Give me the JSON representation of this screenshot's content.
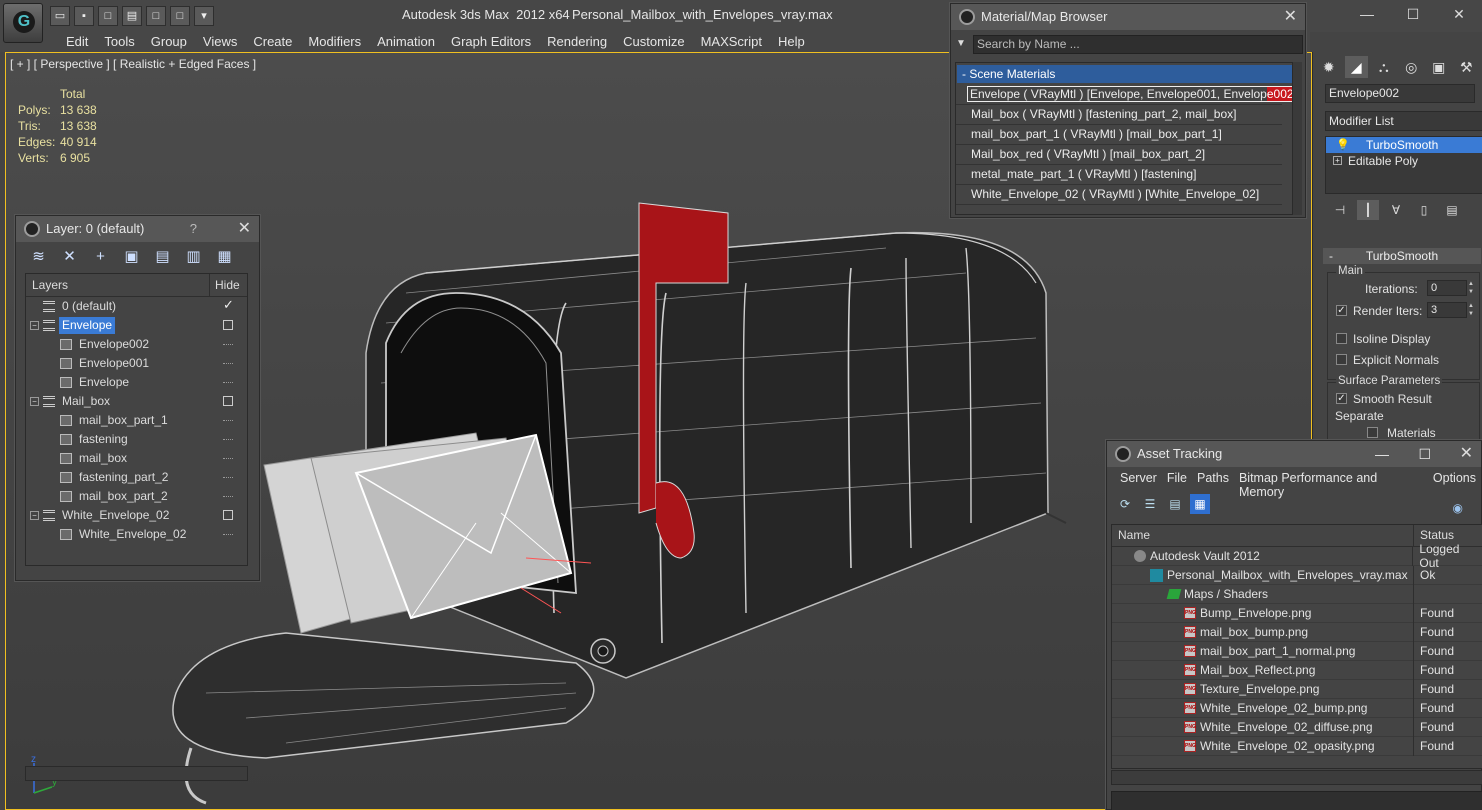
{
  "app": {
    "title": "Autodesk 3ds Max  2012 x64",
    "file": "Personal_Mailbox_with_Envelopes_vray.max",
    "logo_letter": "G"
  },
  "menu": [
    "Edit",
    "Tools",
    "Group",
    "Views",
    "Create",
    "Modifiers",
    "Animation",
    "Graph Editors",
    "Rendering",
    "Customize",
    "MAXScript",
    "Help"
  ],
  "viewport": {
    "label": "[ + ] [ Perspective ] [ Realistic + Edged Faces ]",
    "stats": {
      "header": "Total",
      "rows": [
        {
          "k": "Polys:",
          "v": "13 638"
        },
        {
          "k": "Tris:",
          "v": "13 638"
        },
        {
          "k": "Edges:",
          "v": "40 914"
        },
        {
          "k": "Verts:",
          "v": "6 905"
        }
      ]
    },
    "axis": {
      "z": "z",
      "y": "y",
      "x": "x"
    }
  },
  "layer_panel": {
    "title": "Layer: 0 (default)",
    "help": "?",
    "columns": {
      "name": "Layers",
      "hide": "Hide"
    },
    "rows": [
      {
        "label": "0 (default)",
        "type": "layer",
        "indent": 0,
        "hide": "check"
      },
      {
        "label": "Envelope",
        "type": "layer",
        "indent": 0,
        "hide": "box",
        "selected": true,
        "expand": "⊟"
      },
      {
        "label": "Envelope002",
        "type": "object",
        "indent": 1,
        "hide": "dash"
      },
      {
        "label": "Envelope001",
        "type": "object",
        "indent": 1,
        "hide": "dash"
      },
      {
        "label": "Envelope",
        "type": "object",
        "indent": 1,
        "hide": "dash"
      },
      {
        "label": "Mail_box",
        "type": "layer",
        "indent": 0,
        "hide": "box",
        "expand": "⊟"
      },
      {
        "label": "mail_box_part_1",
        "type": "object",
        "indent": 1,
        "hide": "dash"
      },
      {
        "label": "fastening",
        "type": "object",
        "indent": 1,
        "hide": "dash"
      },
      {
        "label": "mail_box",
        "type": "object",
        "indent": 1,
        "hide": "dash"
      },
      {
        "label": "fastening_part_2",
        "type": "object",
        "indent": 1,
        "hide": "dash"
      },
      {
        "label": "mail_box_part_2",
        "type": "object",
        "indent": 1,
        "hide": "dash"
      },
      {
        "label": "White_Envelope_02",
        "type": "layer",
        "indent": 0,
        "hide": "box",
        "expand": "⊟"
      },
      {
        "label": "White_Envelope_02",
        "type": "object",
        "indent": 1,
        "hide": "dash"
      }
    ]
  },
  "material_browser": {
    "title": "Material/Map Browser",
    "search_placeholder": "Search by Name ...",
    "group": "- Scene Materials",
    "rows": [
      {
        "pre": "Envelope  ( VRayMtl )  [Envelope, Envelope001, Envelop",
        "hl": "e002]",
        "selected": true
      },
      {
        "pre": "Mail_box  ( VRayMtl )  [fastening_part_2, mail_box]",
        "hl": ""
      },
      {
        "pre": "mail_box_part_1  ( VRayMtl )  [mail_box_part_1]",
        "hl": ""
      },
      {
        "pre": "Mail_box_red  ( VRayMtl )  [mail_box_part_2]",
        "hl": ""
      },
      {
        "pre": "metal_mate_part_1  ( VRayMtl )  [fastening]",
        "hl": ""
      },
      {
        "pre": "White_Envelope_02  ( VRayMtl )  [White_Envelope_02]",
        "hl": ""
      }
    ]
  },
  "command_panel": {
    "object_name": "Envelope002",
    "modifier_list": "Modifier List",
    "stack": [
      {
        "label": "TurboSmooth",
        "selected": true
      },
      {
        "label": "Editable Poly",
        "selected": false
      }
    ],
    "rollout": {
      "title": "TurboSmooth",
      "main_group": "Main",
      "iterations_label": "Iterations:",
      "iterations_value": "0",
      "render_iters_label": "Render Iters:",
      "render_iters_value": "3",
      "render_iters_checked": "✓",
      "isoline": "Isoline Display",
      "explicit_normals": "Explicit Normals",
      "surface_group": "Surface Parameters",
      "smooth_result": "Smooth Result",
      "smooth_checked": "✓",
      "separate": "Separate",
      "materials": "Materials"
    }
  },
  "asset_tracking": {
    "title": "Asset Tracking",
    "menu": [
      "Server",
      "File",
      "Paths",
      "Bitmap Performance and Memory",
      "Options"
    ],
    "columns": {
      "name": "Name",
      "status": "Status"
    },
    "rows": [
      {
        "name": "Autodesk Vault 2012",
        "status": "Logged Out",
        "icon": "vault",
        "indent": 22
      },
      {
        "name": "Personal_Mailbox_with_Envelopes_vray.max",
        "status": "Ok",
        "icon": "max",
        "indent": 38
      },
      {
        "name": "Maps / Shaders",
        "status": "",
        "icon": "folder",
        "indent": 56
      },
      {
        "name": "Bump_Envelope.png",
        "status": "Found",
        "icon": "png",
        "indent": 72
      },
      {
        "name": "mail_box_bump.png",
        "status": "Found",
        "icon": "png",
        "indent": 72
      },
      {
        "name": "mail_box_part_1_normal.png",
        "status": "Found",
        "icon": "png",
        "indent": 72
      },
      {
        "name": "Mail_box_Reflect.png",
        "status": "Found",
        "icon": "png",
        "indent": 72
      },
      {
        "name": "Texture_Envelope.png",
        "status": "Found",
        "icon": "png",
        "indent": 72
      },
      {
        "name": "White_Envelope_02_bump.png",
        "status": "Found",
        "icon": "png",
        "indent": 72
      },
      {
        "name": "White_Envelope_02_diffuse.png",
        "status": "Found",
        "icon": "png",
        "indent": 72
      },
      {
        "name": "White_Envelope_02_opasity.png",
        "status": "Found",
        "icon": "png",
        "indent": 72
      }
    ],
    "png_label": "PNG"
  },
  "colors": {
    "selection": "#3a7bd5",
    "viewport_border": "#f0c020",
    "flag": "#a81418",
    "highlight_red": "#c8181e"
  }
}
